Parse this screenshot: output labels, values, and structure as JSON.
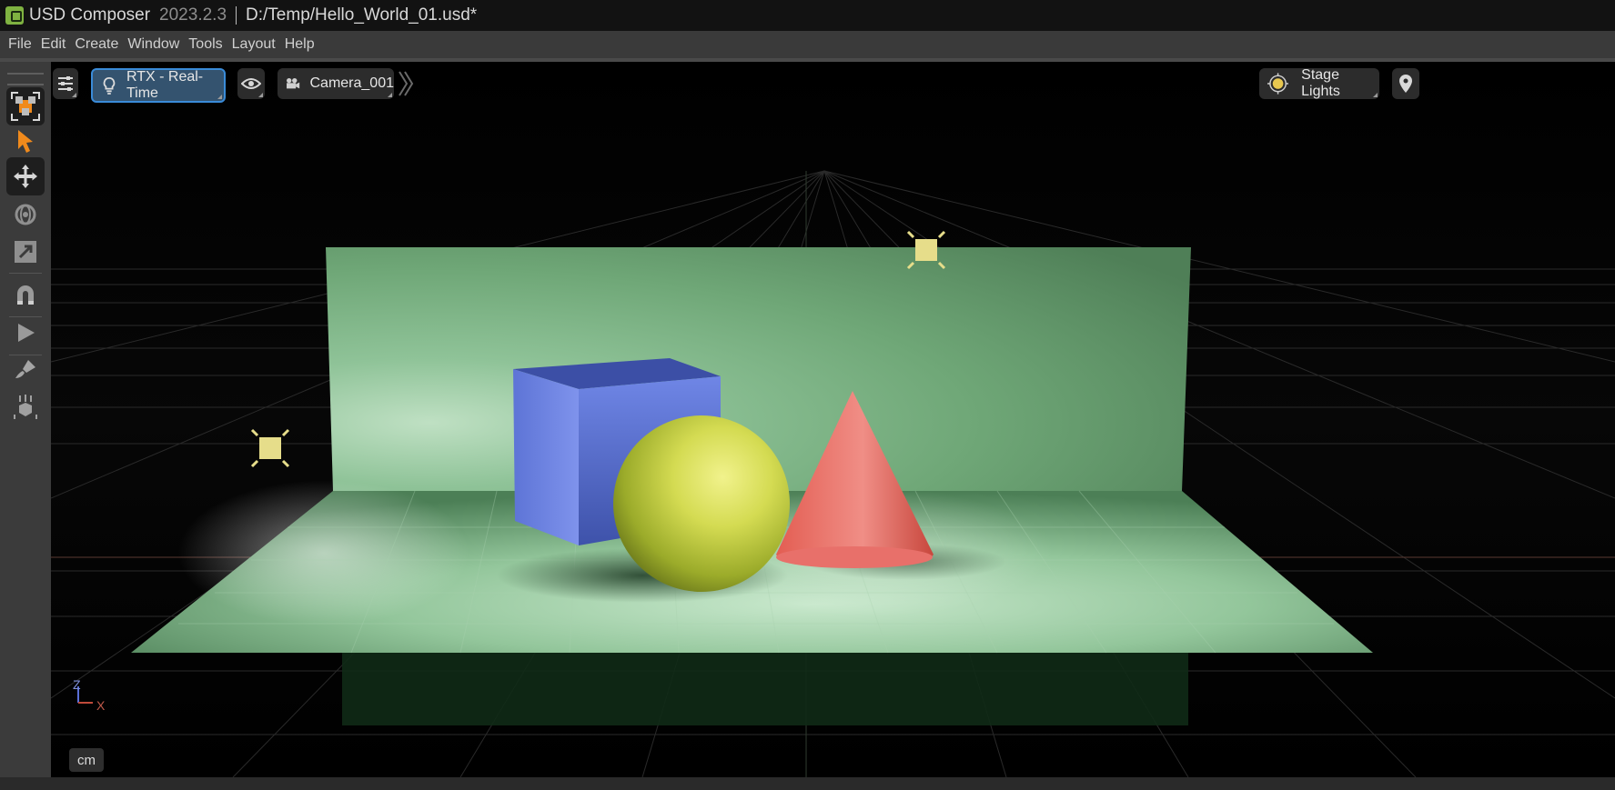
{
  "window": {
    "app_name": "USD Composer",
    "version": "2023.2.3",
    "file_path": "D:/Temp/Hello_World_01.usd*"
  },
  "menu": [
    "File",
    "Edit",
    "Create",
    "Window",
    "Tools",
    "Layout",
    "Help"
  ],
  "left_toolbar": {
    "tools": [
      "frame-selection-icon",
      "select-arrow-icon",
      "move-icon",
      "rotate-icon",
      "scale-icon",
      "snap-magnet-icon",
      "play-icon",
      "paint-brush-icon",
      "drop-to-ground-icon"
    ],
    "active_tool": "move-icon"
  },
  "viewport": {
    "settings_icon": "sliders-icon",
    "renderer": "RTX - Real-Time",
    "visibility_icon": "eye-icon",
    "camera": "Camera_001",
    "lighting_mode": "Stage Lights",
    "units": "cm",
    "axis_z": "Z",
    "axis_x": "X"
  },
  "colors": {
    "accent": "#3a8bd8",
    "cube": "#6a7fe0",
    "sphere": "#c9d24a",
    "cone": "#e0685e",
    "backdrop": "#7fb187",
    "light_gizmo": "#e6dd8a"
  }
}
